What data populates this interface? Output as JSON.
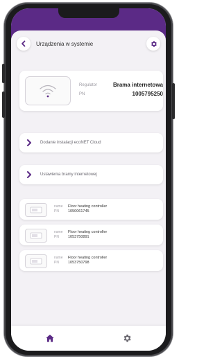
{
  "header": {
    "title": "Urządzenia w systemie",
    "accent_color": "#5b2a86"
  },
  "gateway": {
    "regulator_label": "Regulator",
    "regulator_value": "Brama internetowa",
    "pn_label": "PN",
    "pn_value": "1005795250",
    "icon": "wifi-icon"
  },
  "menu": [
    {
      "label": "Dodanie instalacji ecoNET Cloud",
      "icon": "chevron-right-icon"
    },
    {
      "label": "Ustawienia bramy internetowej",
      "icon": "chevron-right-icon"
    }
  ],
  "devices": [
    {
      "name_label": "name",
      "name": "Floor heating controller",
      "pn_label": "PN",
      "pn": "1050061745"
    },
    {
      "name_label": "name",
      "name": "Floor heating controller",
      "pn_label": "PN",
      "pn": "1053750891"
    },
    {
      "name_label": "name",
      "name": "Floor heating controller",
      "pn_label": "PN",
      "pn": "1053750798"
    }
  ],
  "bottom_nav": [
    {
      "icon": "home-icon"
    },
    {
      "icon": "gear-icon"
    }
  ]
}
